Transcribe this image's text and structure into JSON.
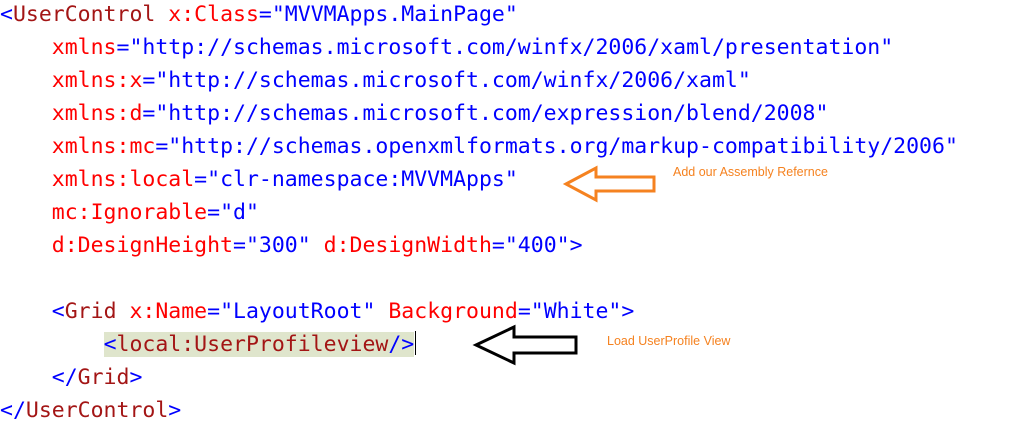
{
  "colors": {
    "tag": "#a31515",
    "attribute": "#ff0000",
    "value": "#0000ff",
    "punct": "#0000ff",
    "highlight": "#dfe5cc",
    "annotation": "#f58220",
    "orange_arrow": "#f58220",
    "black_arrow": "#000000"
  },
  "code": {
    "lines": [
      {
        "indent": 0,
        "tokens": [
          {
            "text": "<",
            "role": "punct"
          },
          {
            "text": "UserControl",
            "role": "tag"
          },
          {
            "text": " x:Class",
            "role": "attribute"
          },
          {
            "text": "=",
            "role": "punct"
          },
          {
            "text": "\"MVVMApps.MainPage\"",
            "role": "value"
          }
        ]
      },
      {
        "indent": 4,
        "tokens": [
          {
            "text": "xmlns",
            "role": "attribute"
          },
          {
            "text": "=",
            "role": "punct"
          },
          {
            "text": "\"http://schemas.microsoft.com/winfx/2006/xaml/presentation\"",
            "role": "value"
          }
        ]
      },
      {
        "indent": 4,
        "tokens": [
          {
            "text": "xmlns:x",
            "role": "attribute"
          },
          {
            "text": "=",
            "role": "punct"
          },
          {
            "text": "\"http://schemas.microsoft.com/winfx/2006/xaml\"",
            "role": "value"
          }
        ]
      },
      {
        "indent": 4,
        "tokens": [
          {
            "text": "xmlns:d",
            "role": "attribute"
          },
          {
            "text": "=",
            "role": "punct"
          },
          {
            "text": "\"http://schemas.microsoft.com/expression/blend/2008\"",
            "role": "value"
          }
        ]
      },
      {
        "indent": 4,
        "tokens": [
          {
            "text": "xmlns:mc",
            "role": "attribute"
          },
          {
            "text": "=",
            "role": "punct"
          },
          {
            "text": "\"http://schemas.openxmlformats.org/markup-compatibility/2006\"",
            "role": "value"
          }
        ]
      },
      {
        "indent": 4,
        "tokens": [
          {
            "text": "xmlns:local",
            "role": "attribute"
          },
          {
            "text": "=",
            "role": "punct"
          },
          {
            "text": "\"clr-namespace:MVVMApps\"",
            "role": "value"
          }
        ]
      },
      {
        "indent": 4,
        "tokens": [
          {
            "text": "mc:Ignorable",
            "role": "attribute"
          },
          {
            "text": "=",
            "role": "punct"
          },
          {
            "text": "\"d\"",
            "role": "value"
          }
        ]
      },
      {
        "indent": 4,
        "tokens": [
          {
            "text": "d:DesignHeight",
            "role": "attribute"
          },
          {
            "text": "=",
            "role": "punct"
          },
          {
            "text": "\"300\"",
            "role": "value"
          },
          {
            "text": " d:DesignWidth",
            "role": "attribute"
          },
          {
            "text": "=",
            "role": "punct"
          },
          {
            "text": "\"400\"",
            "role": "value"
          },
          {
            "text": ">",
            "role": "punct"
          }
        ]
      },
      {
        "indent": 0,
        "tokens": []
      },
      {
        "indent": 4,
        "tokens": [
          {
            "text": "<",
            "role": "punct"
          },
          {
            "text": "Grid",
            "role": "tag"
          },
          {
            "text": " x:Name",
            "role": "attribute"
          },
          {
            "text": "=",
            "role": "punct"
          },
          {
            "text": "\"LayoutRoot\"",
            "role": "value"
          },
          {
            "text": " Background",
            "role": "attribute"
          },
          {
            "text": "=",
            "role": "punct"
          },
          {
            "text": "\"White\"",
            "role": "value"
          },
          {
            "text": ">",
            "role": "punct"
          }
        ]
      },
      {
        "indent": 8,
        "highlight": true,
        "caret": true,
        "tokens": [
          {
            "text": "<",
            "role": "punct"
          },
          {
            "text": "local:UserProfileview",
            "role": "tag"
          },
          {
            "text": "/>",
            "role": "punct"
          }
        ]
      },
      {
        "indent": 4,
        "tokens": [
          {
            "text": "</",
            "role": "punct"
          },
          {
            "text": "Grid",
            "role": "tag"
          },
          {
            "text": ">",
            "role": "punct"
          }
        ]
      },
      {
        "indent": 0,
        "tokens": [
          {
            "text": "</",
            "role": "punct"
          },
          {
            "text": "UserControl",
            "role": "tag"
          },
          {
            "text": ">",
            "role": "punct"
          }
        ]
      }
    ]
  },
  "annotations": {
    "assembly_note": "Add our Assembly Refernce",
    "view_note": "Load UserProfile View"
  }
}
